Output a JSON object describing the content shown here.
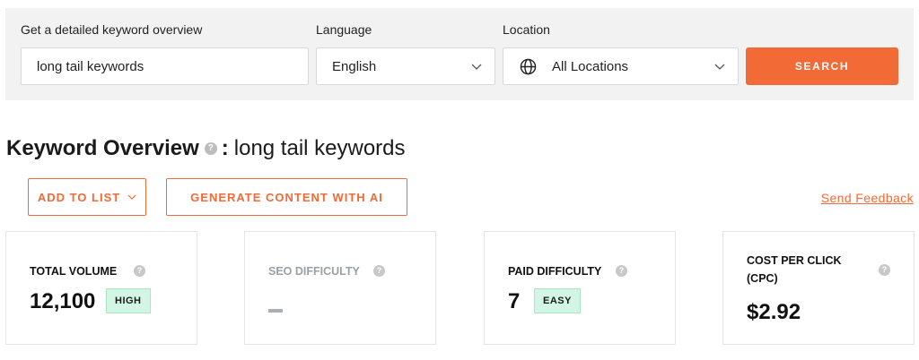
{
  "search": {
    "keyword_label": "Get a detailed keyword overview",
    "keyword_value": "long tail keywords",
    "language_label": "Language",
    "language_value": "English",
    "location_label": "Location",
    "location_value": "All Locations",
    "search_button": "SEARCH"
  },
  "overview": {
    "title": "Keyword Overview",
    "help": "?",
    "colon": ":",
    "keyword": "long tail keywords"
  },
  "actions": {
    "add_to_list": "ADD TO LIST",
    "generate_content": "GENERATE CONTENT WITH AI",
    "send_feedback": "Send Feedback"
  },
  "cards": {
    "total_volume": {
      "label": "TOTAL VOLUME",
      "value": "12,100",
      "badge": "HIGH"
    },
    "seo_difficulty": {
      "label": "SEO DIFFICULTY",
      "value": ""
    },
    "paid_difficulty": {
      "label": "PAID DIFFICULTY",
      "value": "7",
      "badge": "EASY"
    },
    "cpc": {
      "label_line1": "COST PER CLICK",
      "label_line2": "(CPC)",
      "value": "$2.92"
    }
  },
  "colors": {
    "accent": "#f26a36",
    "badge_bg": "#d3f5e5",
    "panel_bg": "#f2f2f2"
  },
  "icons": [
    "globe-icon",
    "chevron-down-icon",
    "help-icon"
  ]
}
